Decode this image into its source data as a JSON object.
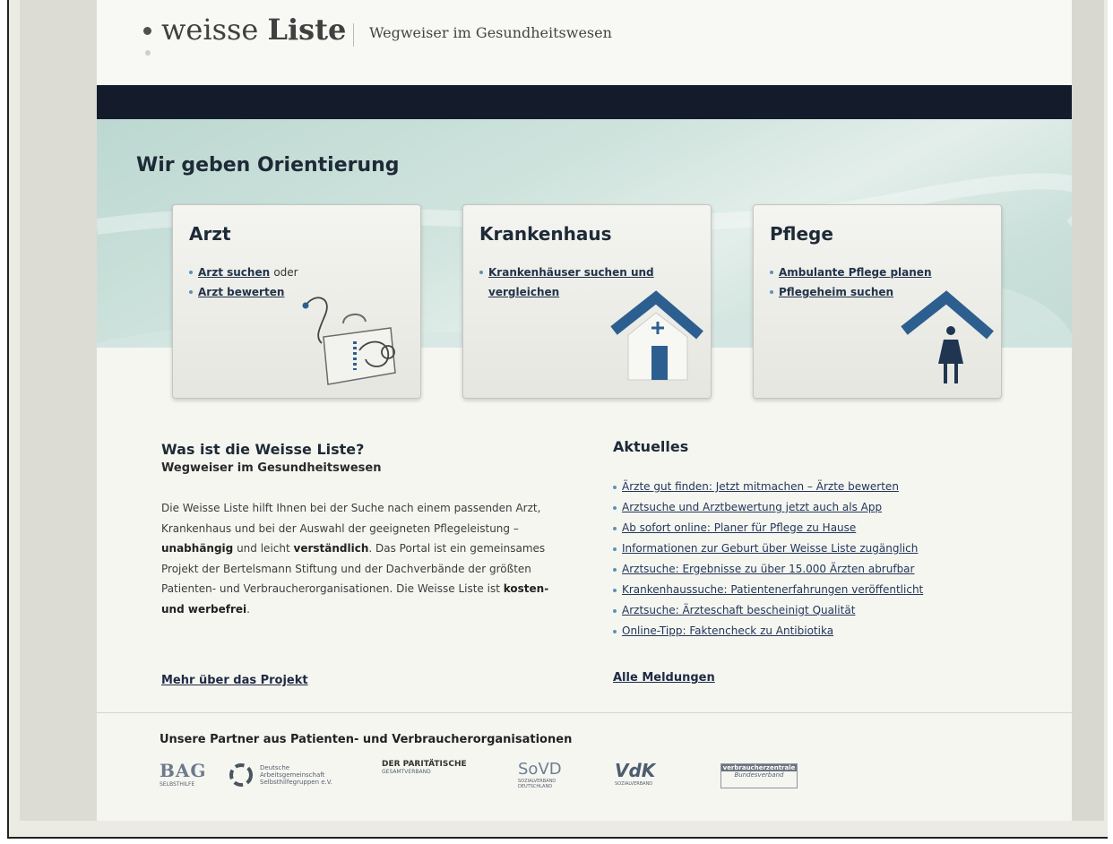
{
  "header": {
    "logo_light": "weisse",
    "logo_bold": "Liste",
    "tagline": "Wegweiser im Gesundheitswesen"
  },
  "hero": {
    "title": "Wir geben Orientierung"
  },
  "cards": [
    {
      "title": "Arzt",
      "links": [
        "Arzt suchen",
        "Arzt bewerten"
      ],
      "joiner": "oder",
      "icon": "doctor-bag-stethoscope-icon"
    },
    {
      "title": "Krankenhaus",
      "links": [
        "Krankenhäuser suchen und vergleichen"
      ],
      "icon": "hospital-house-icon"
    },
    {
      "title": "Pflege",
      "links": [
        "Ambulante Pflege planen",
        "Pflegeheim suchen"
      ],
      "icon": "care-house-nurse-icon"
    }
  ],
  "about": {
    "heading": "Was ist die Weisse Liste?",
    "subheading": "Wegweiser im Gesundheitswesen",
    "text_1": "Die Weisse Liste hilft Ihnen bei der Suche nach einem passenden Arzt, Krankenhaus und bei der Auswahl der geeigneten Pflegeleistung –",
    "bold_1": "unabhängig",
    "text_2": "und leicht",
    "bold_2": "verständlich",
    "text_3": ". Das Portal ist ein gemeinsames Projekt der Bertelsmann Stiftung und der Dachverbände der größten Patienten- und Verbraucherorganisationen. Die Weisse Liste ist",
    "bold_3": "kosten- und werbefrei",
    "text_4": ".",
    "more_link": "Mehr über das Projekt"
  },
  "news": {
    "heading": "Aktuelles",
    "items": [
      "Ärzte gut finden: Jetzt mitmachen – Ärzte bewerten",
      "Arztsuche und Arztbewertung jetzt auch als App",
      "Ab sofort online: Planer für Pflege zu Hause",
      "Informationen zur Geburt über Weisse Liste zugänglich",
      "Arztsuche: Ergebnisse zu über 15.000 Ärzten abrufbar",
      "Krankenhaussuche: Patientenerfahrungen veröffentlicht",
      "Arztsuche: Ärzteschaft bescheinigt Qualität",
      "Online-Tipp: Faktencheck zu Antibiotika"
    ],
    "all_link": "Alle Meldungen"
  },
  "partners": {
    "heading": "Unsere Partner aus Patienten- und Verbraucherorganisationen",
    "logos": [
      {
        "label": "BAG",
        "sub": "SELBSTHILFE"
      },
      {
        "label": "Deutsche Arbeitsgemeinschaft Selbsthilfegruppen e.V.",
        "sub": ""
      },
      {
        "label": "DER PARITÄTISCHE",
        "sub": "GESAMTVERBAND"
      },
      {
        "label": "SoVD",
        "sub": "SOZIALVERBAND DEUTSCHLAND"
      },
      {
        "label": "VdK",
        "sub": "SOZIALVERBAND"
      },
      {
        "label": "verbraucherzentrale",
        "sub": "Bundesverband"
      }
    ]
  },
  "colors": {
    "navbar": "#141c2c",
    "hero_teal": "#bcd8d1",
    "link": "#23375a",
    "bullet": "#5a93b8",
    "icon_blue": "#2c5f8f"
  }
}
